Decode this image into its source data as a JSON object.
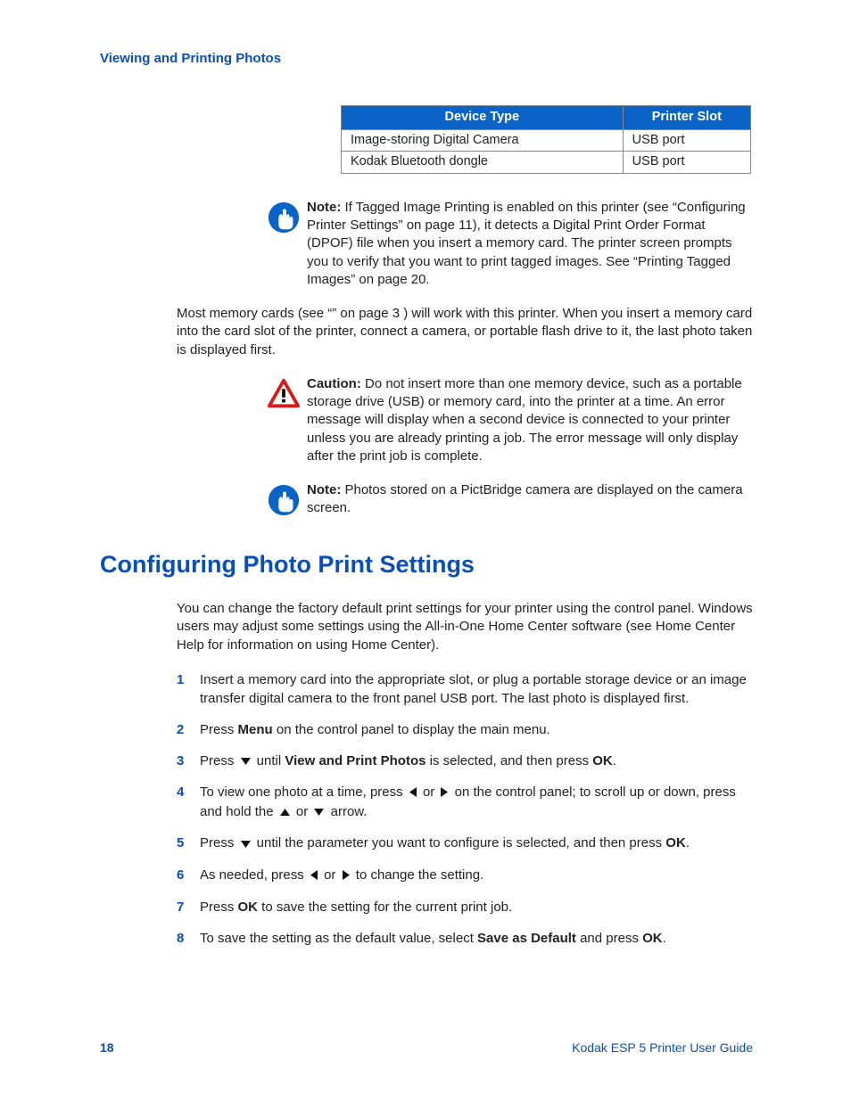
{
  "header": {
    "running_title": "Viewing and Printing Photos"
  },
  "table": {
    "col1_header": "Device Type",
    "col2_header": "Printer Slot",
    "rows": [
      {
        "c1": "Image-storing Digital Camera",
        "c2": "USB port"
      },
      {
        "c1": "Kodak Bluetooth dongle",
        "c2": "USB port"
      }
    ]
  },
  "note1": {
    "label": "Note:",
    "text": "  If Tagged Image Printing is enabled on this printer (see “Configuring Printer Settings” on page 11), it detects a Digital Print Order Format (DPOF) file when you insert a memory card. The printer screen prompts you to verify that you want to print tagged images. See “Printing Tagged Images” on page 20."
  },
  "body_para": "Most memory cards (see “” on page 3 ) will work with this printer. When you insert a memory card into the card slot of the printer, connect a camera, or portable flash drive to it, the last photo taken is displayed first.",
  "caution": {
    "label": "Caution:",
    "text": " Do not insert more than one memory device, such as a portable storage drive (USB) or memory card, into the printer at a time. An error message will display when a second device is connected to your printer unless you are already printing a job. The error message will only display after the print job is complete."
  },
  "note2": {
    "label": "Note:",
    "text": "  Photos stored on a PictBridge camera are displayed on the camera screen."
  },
  "section_heading": "Configuring Photo Print Settings",
  "intro": "You can change the factory default print settings for your printer using the control panel. Windows users may adjust some settings using the All-in-One Home Center software (see Home Center Help for information on using Home Center).",
  "steps": {
    "s1": "Insert a memory card into the appropriate slot, or plug a portable storage device or an image transfer digital camera to the front panel USB port. The last photo is displayed first.",
    "s2_a": "Press ",
    "s2_menu": "Menu",
    "s2_b": " on the control panel to display the main menu.",
    "s3_a": "Press ",
    "s3_b": " until ",
    "s3_view": "View and Print Photos",
    "s3_c": " is selected, and then press ",
    "s3_ok": "OK",
    "s3_d": ".",
    "s4_a": "To view one photo at a time, press ",
    "s4_b": " or ",
    "s4_c": " on the control panel; to scroll up or down, press and hold the ",
    "s4_d": " or ",
    "s4_e": " arrow.",
    "s5_a": "Press ",
    "s5_b": " until the parameter you want to configure is selected, and then press ",
    "s5_ok": "OK",
    "s5_c": ".",
    "s6_a": "As needed, press ",
    "s6_b": " or ",
    "s6_c": " to change the setting.",
    "s7_a": "Press ",
    "s7_ok": "OK",
    "s7_b": " to save the setting for the current print job.",
    "s8_a": "To save the setting as the default value, select ",
    "s8_save": "Save as Default",
    "s8_b": " and press ",
    "s8_ok": "OK",
    "s8_c": "."
  },
  "footer": {
    "page": "18",
    "guide": "Kodak ESP 5 Printer User Guide"
  }
}
